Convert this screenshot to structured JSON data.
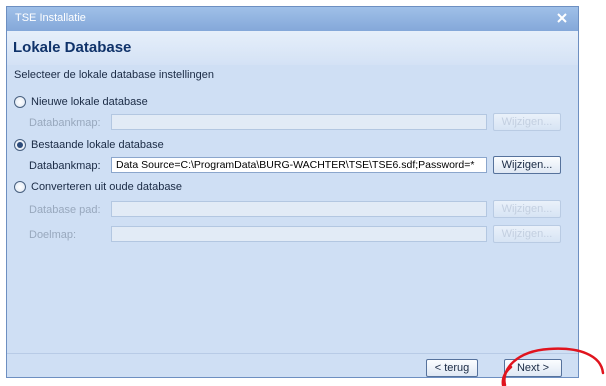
{
  "window": {
    "title": "TSE Installatie"
  },
  "header": {
    "title": "Lokale Database"
  },
  "subtitle": "Selecteer de lokale database instellingen",
  "options": {
    "new": {
      "label": "Nieuwe lokale database",
      "checked": false,
      "field_label": "Databankmap:",
      "value": "",
      "button": "Wijzigen..."
    },
    "existing": {
      "label": "Bestaande lokale database",
      "checked": true,
      "field_label": "Databankmap:",
      "value": "Data Source=C:\\ProgramData\\BURG-WACHTER\\TSE\\TSE6.sdf;Password=*",
      "button": "Wijzigen..."
    },
    "convert": {
      "label": "Converteren uit oude database",
      "checked": false,
      "db_path_label": "Database pad:",
      "db_path_value": "",
      "db_path_button": "Wijzigen...",
      "target_label": "Doelmap:",
      "target_value": "",
      "target_button": "Wijzigen..."
    }
  },
  "footer": {
    "back_label": "< terug",
    "next_label": "Next >"
  },
  "colors": {
    "window_bg": "#cfdff4",
    "heading": "#10336a",
    "annotation": "#e0141e"
  }
}
